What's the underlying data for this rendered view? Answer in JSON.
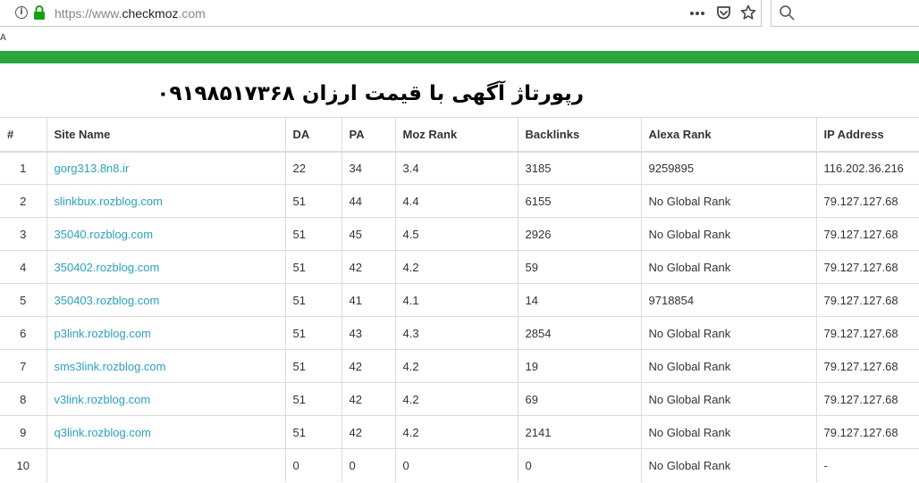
{
  "browser": {
    "url_scheme": "https://www.",
    "url_host": "checkmoz",
    "url_tld": ".com"
  },
  "stray_mark": "A",
  "banner": {
    "text": "رپورتاژ آگهی با قیمت ارزان  ۰۹۱۹۸۵۱۷۳۶۸"
  },
  "accent_color": "#2aa540",
  "link_color": "#2aa1bd",
  "table": {
    "headers": [
      "#",
      "Site Name",
      "DA",
      "PA",
      "Moz Rank",
      "Backlinks",
      "Alexa Rank",
      "IP Address"
    ],
    "rows": [
      [
        "1",
        "gorg313.8n8.ir",
        "22",
        "34",
        "3.4",
        "3185",
        "9259895",
        "116.202.36.216"
      ],
      [
        "2",
        "slinkbux.rozblog.com",
        "51",
        "44",
        "4.4",
        "6155",
        "No Global Rank",
        "79.127.127.68"
      ],
      [
        "3",
        "35040.rozblog.com",
        "51",
        "45",
        "4.5",
        "2926",
        "No Global Rank",
        "79.127.127.68"
      ],
      [
        "4",
        "350402.rozblog.com",
        "51",
        "42",
        "4.2",
        "59",
        "No Global Rank",
        "79.127.127.68"
      ],
      [
        "5",
        "350403.rozblog.com",
        "51",
        "41",
        "4.1",
        "14",
        "9718854",
        "79.127.127.68"
      ],
      [
        "6",
        "p3link.rozblog.com",
        "51",
        "43",
        "4.3",
        "2854",
        "No Global Rank",
        "79.127.127.68"
      ],
      [
        "7",
        "sms3link.rozblog.com",
        "51",
        "42",
        "4.2",
        "19",
        "No Global Rank",
        "79.127.127.68"
      ],
      [
        "8",
        "v3link.rozblog.com",
        "51",
        "42",
        "4.2",
        "69",
        "No Global Rank",
        "79.127.127.68"
      ],
      [
        "9",
        "q3link.rozblog.com",
        "51",
        "42",
        "4.2",
        "2141",
        "No Global Rank",
        "79.127.127.68"
      ],
      [
        "10",
        "",
        "0",
        "0",
        "0",
        "0",
        "No Global Rank",
        "-"
      ]
    ]
  }
}
